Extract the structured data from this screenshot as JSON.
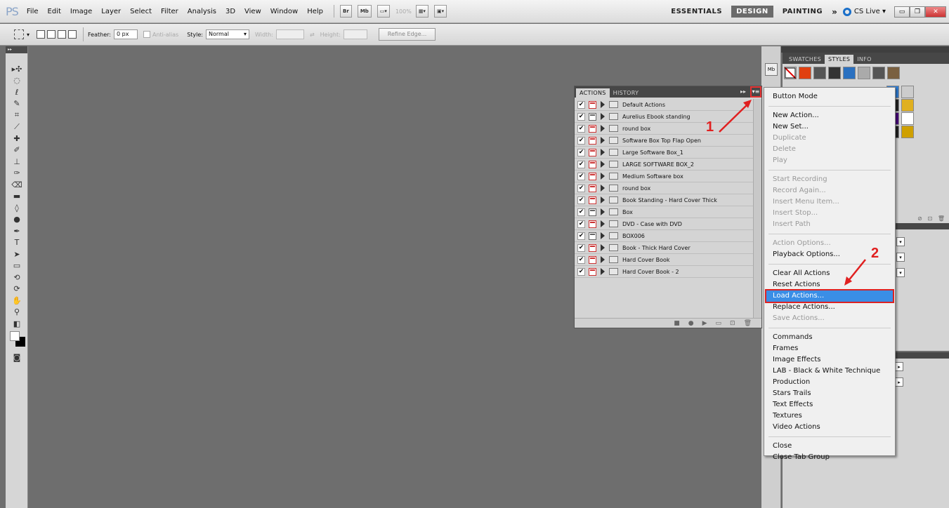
{
  "app": {
    "logo": "PS",
    "menus": [
      "File",
      "Edit",
      "Image",
      "Layer",
      "Select",
      "Filter",
      "Analysis",
      "3D",
      "View",
      "Window",
      "Help"
    ],
    "bridge_btn": "Br",
    "minibridge_btn": "Mb",
    "zoom_value": "100%"
  },
  "workspaces": {
    "items": [
      "ESSENTIALS",
      "DESIGN",
      "PAINTING"
    ],
    "active": "DESIGN",
    "more": "»",
    "cs_live": "CS Live ▾"
  },
  "options": {
    "feather_label": "Feather:",
    "feather_value": "0 px",
    "antialias_label": "Anti-alias",
    "style_label": "Style:",
    "style_value": "Normal",
    "width_label": "Width:",
    "height_label": "Height:",
    "refine_edge": "Refine Edge..."
  },
  "actions_panel": {
    "tabs": [
      "ACTIONS",
      "HISTORY"
    ],
    "active_tab": "ACTIONS",
    "items": [
      {
        "label": "Default Actions",
        "dialog": "red"
      },
      {
        "label": "Aurelius Ebook standing",
        "dialog": "plain"
      },
      {
        "label": "round box",
        "dialog": "red"
      },
      {
        "label": "Software Box Top Flap Open",
        "dialog": "red"
      },
      {
        "label": "Large Software Box_1",
        "dialog": "red"
      },
      {
        "label": "LARGE SOFTWARE BOX_2",
        "dialog": "red"
      },
      {
        "label": "Medium Software box",
        "dialog": "red"
      },
      {
        "label": "round box",
        "dialog": "red"
      },
      {
        "label": "Book Standing - Hard Cover Thick",
        "dialog": "red"
      },
      {
        "label": "Box",
        "dialog": "plain"
      },
      {
        "label": "DVD - Case with DVD",
        "dialog": "red"
      },
      {
        "label": "BOX006",
        "dialog": "plain"
      },
      {
        "label": "Book - Thick Hard Cover",
        "dialog": "red"
      },
      {
        "label": "Hard Cover Book",
        "dialog": "red"
      },
      {
        "label": "Hard Cover Book - 2",
        "dialog": "red"
      }
    ],
    "check_mark": "✔"
  },
  "styles_panel": {
    "tabs": [
      "SWATCHES",
      "STYLES",
      "INFO"
    ],
    "active_tab": "STYLES",
    "mb_label": "Mb"
  },
  "flyout_menu": {
    "groups": [
      [
        {
          "label": "Button Mode",
          "enabled": true
        }
      ],
      [
        {
          "label": "New Action...",
          "enabled": true
        },
        {
          "label": "New Set...",
          "enabled": true
        },
        {
          "label": "Duplicate",
          "enabled": false
        },
        {
          "label": "Delete",
          "enabled": false
        },
        {
          "label": "Play",
          "enabled": false
        }
      ],
      [
        {
          "label": "Start Recording",
          "enabled": false
        },
        {
          "label": "Record Again...",
          "enabled": false
        },
        {
          "label": "Insert Menu Item...",
          "enabled": false
        },
        {
          "label": "Insert Stop...",
          "enabled": false
        },
        {
          "label": "Insert Path",
          "enabled": false
        }
      ],
      [
        {
          "label": "Action Options...",
          "enabled": false
        },
        {
          "label": "Playback Options...",
          "enabled": true
        }
      ],
      [
        {
          "label": "Clear All Actions",
          "enabled": true
        },
        {
          "label": "Reset Actions",
          "enabled": true
        },
        {
          "label": "Load Actions...",
          "enabled": true,
          "highlighted": true
        },
        {
          "label": "Replace Actions...",
          "enabled": true
        },
        {
          "label": "Save Actions...",
          "enabled": false
        }
      ],
      [
        {
          "label": "Commands",
          "enabled": true
        },
        {
          "label": "Frames",
          "enabled": true
        },
        {
          "label": "Image Effects",
          "enabled": true
        },
        {
          "label": "LAB - Black & White Technique",
          "enabled": true
        },
        {
          "label": "Production",
          "enabled": true
        },
        {
          "label": "Stars Trails",
          "enabled": true
        },
        {
          "label": "Text Effects",
          "enabled": true
        },
        {
          "label": "Textures",
          "enabled": true
        },
        {
          "label": "Video Actions",
          "enabled": true
        }
      ],
      [
        {
          "label": "Close",
          "enabled": true
        },
        {
          "label": "Close Tab Group",
          "enabled": true
        }
      ]
    ]
  },
  "annotations": {
    "step1": "1",
    "step2": "2",
    "color": "#e02020"
  },
  "colors": {
    "workspace_bg": "#6e6e6e",
    "panel_bg": "#d4d4d4",
    "menu_highlight": "#3a8ee6"
  }
}
